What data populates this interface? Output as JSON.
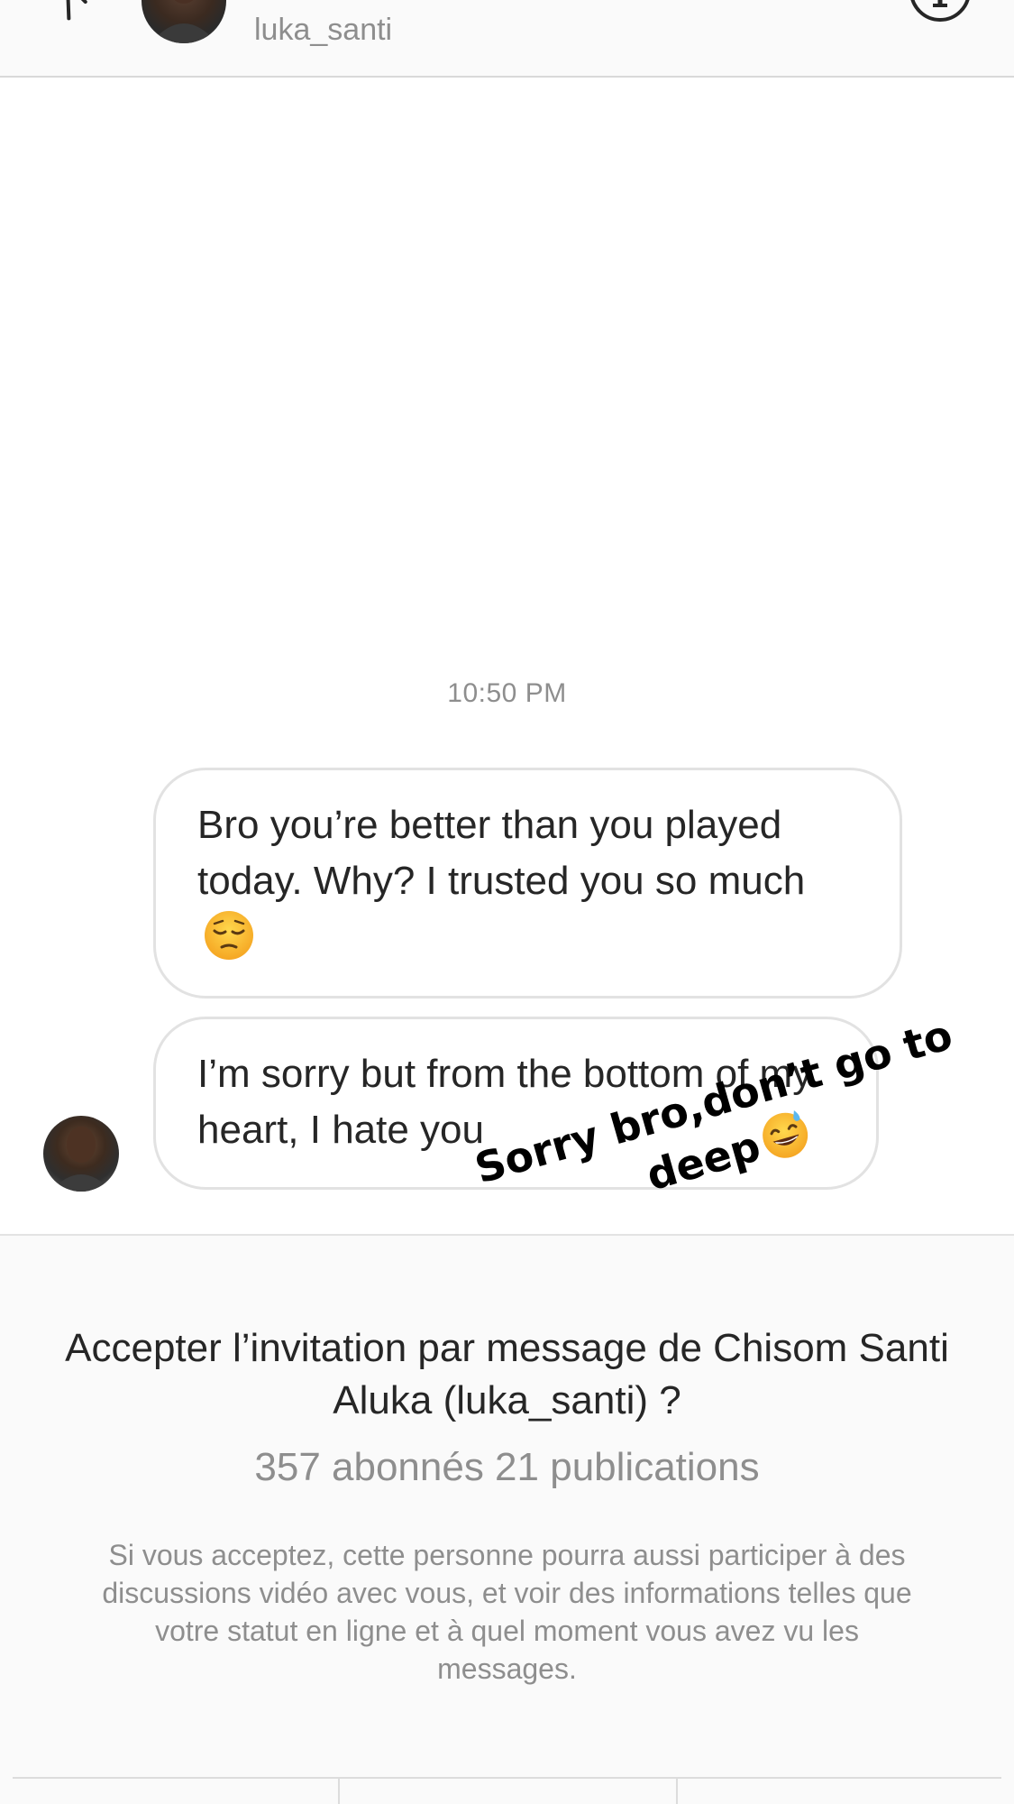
{
  "header": {
    "username": "luka_santi",
    "back_icon": "chevron-left-icon",
    "info_icon": "info-icon"
  },
  "chat": {
    "timestamp": "10:50 PM",
    "messages": [
      {
        "text": "Bro you’re better than you played today. Why? I trusted you so much",
        "emoji": "pensive-face"
      },
      {
        "text": "I’m sorry but from the bottom of my heart, I hate you"
      }
    ]
  },
  "request": {
    "title": "Accepter l’invitation par message de Chisom Santi Aluka (luka_santi) ?",
    "counts": "357 abonnés 21 publications",
    "notice": "Si vous acceptez, cette personne pourra aussi participer à des discussions vidéo avec vous, et voir des informations telles que votre statut en ligne et à quel moment vous avez vu les messages."
  },
  "sticker": {
    "text": "Sorry bro,don’t go to deep",
    "emoji": "grinning-sweat-face"
  },
  "colors": {
    "text_primary": "#262626",
    "text_secondary": "#8e8e8e",
    "bubble_border": "#e2e2e2",
    "panel_background": "#fafafa"
  }
}
